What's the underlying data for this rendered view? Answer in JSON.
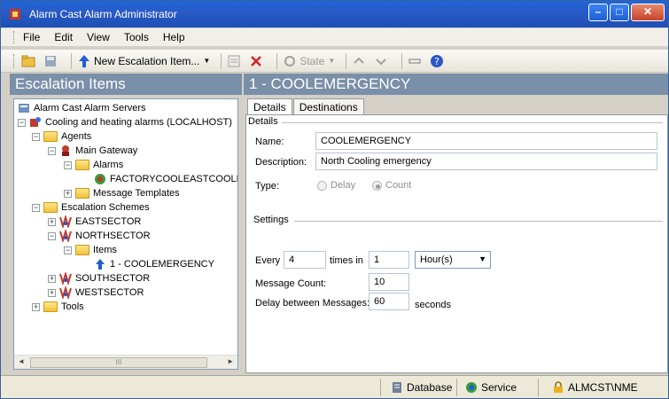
{
  "window": {
    "title": "Alarm Cast Alarm Administrator"
  },
  "menu": [
    "File",
    "Edit",
    "View",
    "Tools",
    "Help"
  ],
  "toolbar": {
    "new_item_label": "New Escalation Item...",
    "state_label": "State"
  },
  "left_panel": {
    "title": "Escalation Items",
    "tree": {
      "root": "Alarm Cast Alarm Servers",
      "server": "Cooling and heating alarms (LOCALHOST)",
      "agents": "Agents",
      "main_gateway": "Main Gateway",
      "alarms": "Alarms",
      "alarm_item": "FACTORYCOOLEASTCOOLEa",
      "message_templates": "Message Templates",
      "escalation_schemes": "Escalation Schemes",
      "eastsector": "EASTSECTOR",
      "northsector": "NORTHSECTOR",
      "items": "Items",
      "selected_item": "1 - COOLEMERGENCY",
      "southsector": "SOUTHSECTOR",
      "westsector": "WESTSECTOR",
      "tools": "Tools"
    },
    "scroll_thumb": "III"
  },
  "right_panel": {
    "title": "1 - COOLEMERGENCY",
    "tabs": [
      "Details",
      "Destinations"
    ],
    "details_group": "Details",
    "name_label": "Name:",
    "name_value": "COOLEMERGENCY",
    "description_label": "Description:",
    "description_value": "North Cooling emergency",
    "type_label": "Type:",
    "type_options": [
      "Delay",
      "Count"
    ],
    "type_selected": "Count",
    "settings_group": "Settings",
    "every_label": "Every",
    "every_value": "4",
    "times_in_label": "times in",
    "times_in_value": "1",
    "period_value": "Hour(s)",
    "message_count_label": "Message Count:",
    "message_count_value": "10",
    "delay_label": "Delay between Messages:",
    "delay_value": "60",
    "seconds_label": "seconds"
  },
  "statusbar": {
    "database": "Database",
    "service": "Service",
    "user": "ALMCST\\NME"
  },
  "colors": {
    "title_bar": "#2a5bc7",
    "panel_header": "#7a8fa8"
  }
}
